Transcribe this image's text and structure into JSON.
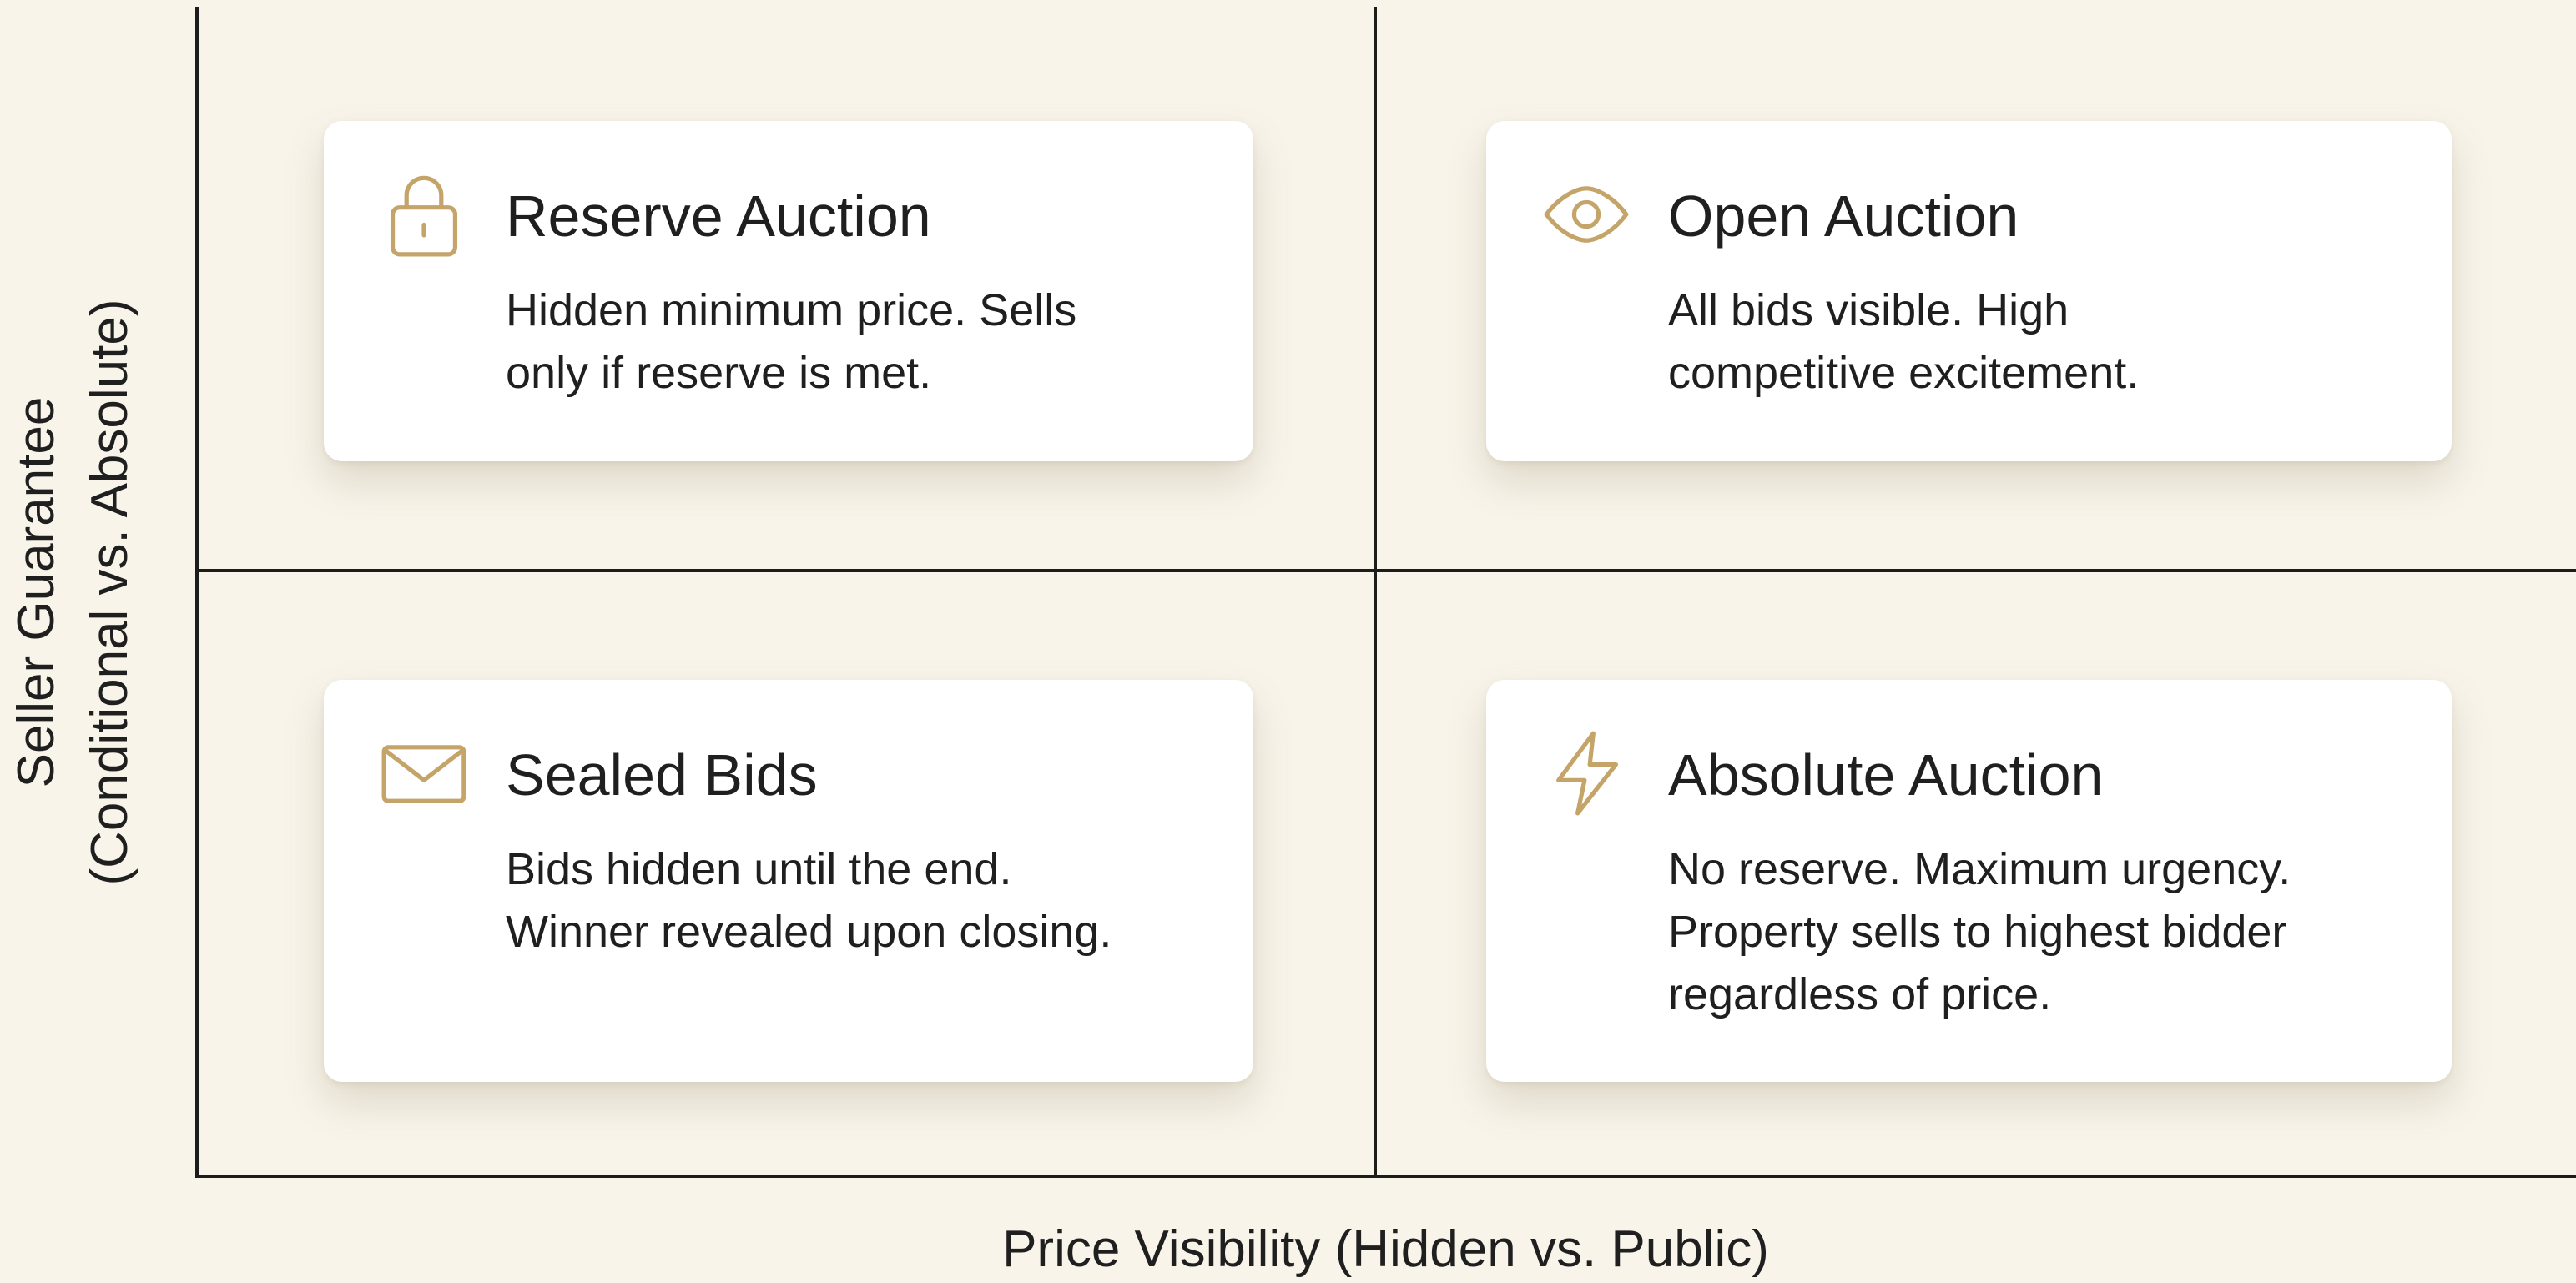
{
  "axes": {
    "x_label": "Price Visibility (Hidden vs. Public)",
    "y_label_line1": "Seller Guarantee",
    "y_label_line2": "(Conditional vs. Absolute)"
  },
  "quadrants": [
    {
      "position": "top-left",
      "icon": "lock-icon",
      "title": "Reserve Auction",
      "description_lines": [
        "Hidden minimum price. Sells",
        "only if reserve is met."
      ]
    },
    {
      "position": "top-right",
      "icon": "eye-icon",
      "title": "Open Auction",
      "description_lines": [
        "All bids visible. High",
        "competitive excitement."
      ]
    },
    {
      "position": "bottom-left",
      "icon": "envelope-icon",
      "title": "Sealed Bids",
      "description_lines": [
        "Bids hidden until the end.",
        "Winner revealed upon closing."
      ]
    },
    {
      "position": "bottom-right",
      "icon": "lightning-icon",
      "title": "Absolute Auction",
      "description_lines": [
        "No reserve. Maximum urgency.",
        "Property sells to highest bidder",
        "regardless of price."
      ]
    }
  ],
  "colors": {
    "background": "#f8f4ea",
    "icon_gold": "#c4a468",
    "axis": "#1c1c1c",
    "card": "#ffffff"
  }
}
